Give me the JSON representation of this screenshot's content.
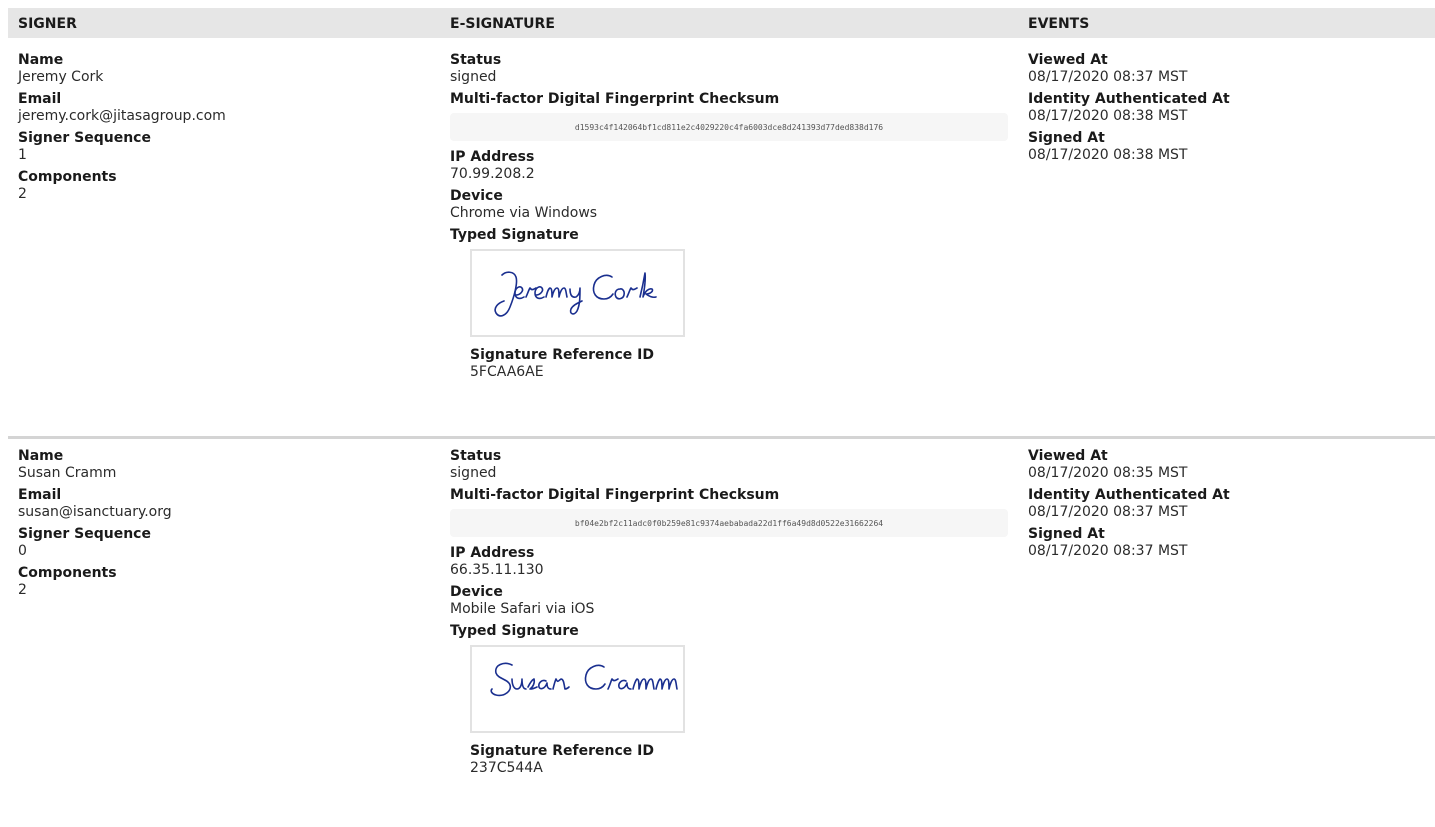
{
  "headers": {
    "signer": "SIGNER",
    "esignature": "E-SIGNATURE",
    "events": "EVENTS"
  },
  "labels": {
    "name": "Name",
    "email": "Email",
    "sequence": "Signer Sequence",
    "components": "Components",
    "status": "Status",
    "checksum": "Multi-factor Digital Fingerprint Checksum",
    "ip": "IP Address",
    "device": "Device",
    "typed_signature": "Typed Signature",
    "sig_ref": "Signature Reference ID",
    "viewed": "Viewed At",
    "identity": "Identity Authenticated At",
    "signed": "Signed At"
  },
  "signers": [
    {
      "name": "Jeremy Cork",
      "email": "jeremy.cork@jitasagroup.com",
      "sequence": "1",
      "components": "2",
      "status": "signed",
      "checksum": "d1593c4f142064bf1cd811e2c4029220c4fa6003dce8d241393d77ded838d176",
      "ip": "70.99.208.2",
      "device": "Chrome via Windows",
      "signature_image": "Jeremy Cork",
      "sig_ref": "5FCAA6AE",
      "viewed": "08/17/2020 08:37 MST",
      "identity": "08/17/2020 08:38 MST",
      "signed": "08/17/2020 08:38 MST"
    },
    {
      "name": "Susan Cramm",
      "email": "susan@isanctuary.org",
      "sequence": "0",
      "components": "2",
      "status": "signed",
      "checksum": "bf04e2bf2c11adc0f0b259e81c9374aebabada22d1ff6a49d8d0522e31662264",
      "ip": "66.35.11.130",
      "device": "Mobile Safari via iOS",
      "signature_image": "Susan Cramm",
      "sig_ref": "237C544A",
      "viewed": "08/17/2020 08:35 MST",
      "identity": "08/17/2020 08:37 MST",
      "signed": "08/17/2020 08:37 MST"
    }
  ],
  "colors": {
    "header_bg": "#e6e6e6",
    "signature_ink": "#1a2f8f"
  }
}
